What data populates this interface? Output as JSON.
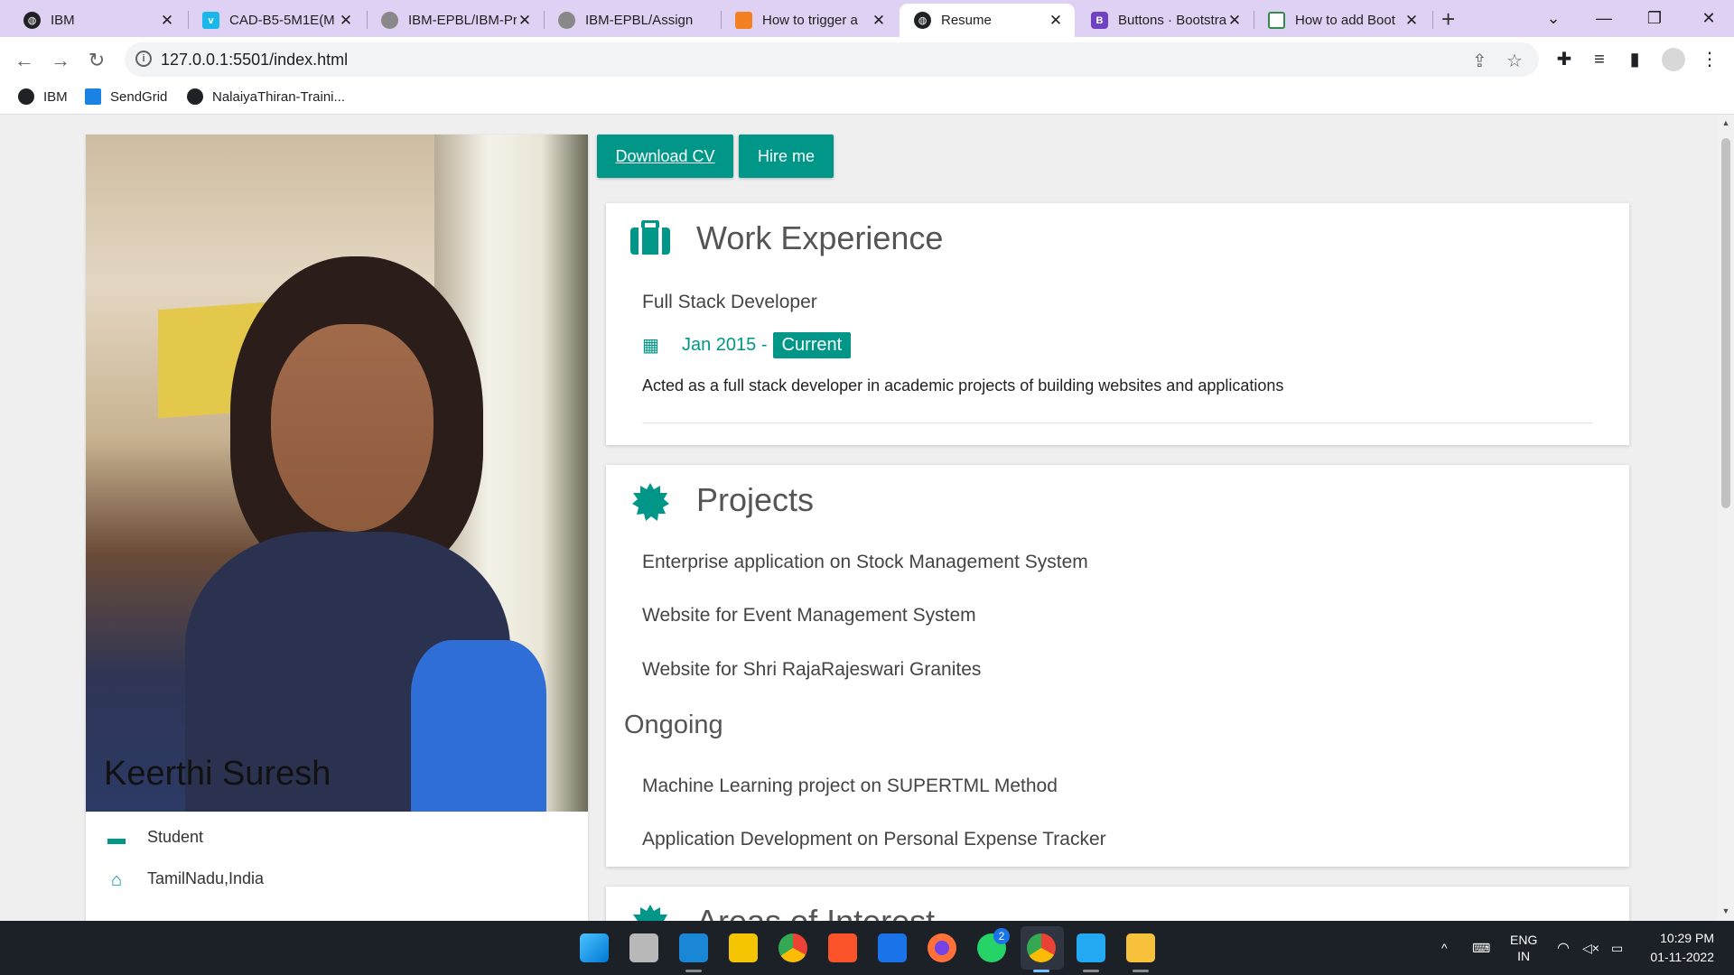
{
  "browser": {
    "tabs": [
      {
        "title": "IBM",
        "favicon": "globe-icon",
        "color": "#202124"
      },
      {
        "title": "CAD-B5-5M1E(M",
        "favicon": "vimeo-icon",
        "color": "#1ab7ea"
      },
      {
        "title": "IBM-EPBL/IBM-Pr",
        "favicon": "github-icon",
        "color": "#888888"
      },
      {
        "title": "IBM-EPBL/Assign",
        "favicon": "github-icon",
        "color": "#888888"
      },
      {
        "title": "How to trigger a",
        "favicon": "flame-icon",
        "color": "#f48024"
      },
      {
        "title": "Resume",
        "favicon": "globe-icon",
        "color": "#202124"
      },
      {
        "title": "Buttons · Bootstra",
        "favicon": "bootstrap-icon",
        "color": "#6f42c1"
      },
      {
        "title": "How to add Boot",
        "favicon": "gfg-icon",
        "color": "#2f8d46"
      }
    ],
    "url": "127.0.0.1:5501/index.html",
    "bookmarks": [
      {
        "label": "IBM"
      },
      {
        "label": "SendGrid"
      },
      {
        "label": "NalaiyaThiran-Traini..."
      }
    ]
  },
  "profile": {
    "name": "Keerthi Suresh",
    "role": "Student",
    "location": "TamilNadu,India"
  },
  "actions": {
    "download": "Download CV",
    "hire": "Hire me"
  },
  "work": {
    "heading": "Work Experience",
    "job_title": "Full Stack Developer",
    "date_from": "Jan 2015 -",
    "date_badge": "Current",
    "description": "Acted as a full stack developer in academic projects of building websites and applications"
  },
  "projects": {
    "heading": "Projects",
    "items": [
      "Enterprise application on Stock Management System",
      "Website for Event Management System",
      "Website for Shri RajaRajeswari Granites"
    ],
    "ongoing_heading": "Ongoing",
    "ongoing": [
      "Machine Learning project on SUPERTML Method",
      "Application Development on Personal Expense Tracker"
    ]
  },
  "interests": {
    "heading": "Areas of Interest"
  },
  "taskbar": {
    "lang_top": "ENG",
    "lang_bottom": "IN",
    "time": "10:29 PM",
    "date": "01-11-2022",
    "whatsapp_badge": "2"
  },
  "theme": {
    "accent": "#009688"
  }
}
